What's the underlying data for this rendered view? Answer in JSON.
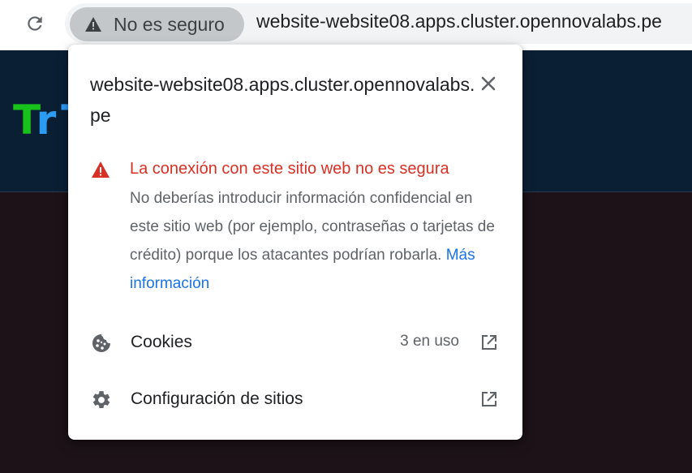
{
  "toolbar": {
    "security_chip_label": "No es seguro",
    "url": "website-website08.apps.cluster.opennovalabs.pe"
  },
  "site": {
    "logo_letter_1": "T",
    "logo_letter_2": "r",
    "logo_rest": "T"
  },
  "popup": {
    "title": "website-website08.apps.cluster.opennovalabs.pe",
    "warning_heading": "La conexión con este sitio web no es segura",
    "warning_body": "No deberías introducir información confidencial en este sitio web (por ejemplo, contraseñas o tarjetas de crédito) porque los atacantes podrían robarla.",
    "learn_more_link": "Más información",
    "cookies_label": "Cookies",
    "cookies_count": "3 en uso",
    "site_settings_label": "Configuración de sitios"
  },
  "colors": {
    "warning_red": "#d93025",
    "link_blue": "#1a73e8",
    "header_navy": "#0b1f34",
    "page_dark": "#1c1217"
  },
  "icons": [
    "reload-icon",
    "warning-icon",
    "close-icon",
    "cookie-icon",
    "gear-icon",
    "open-external-icon"
  ]
}
